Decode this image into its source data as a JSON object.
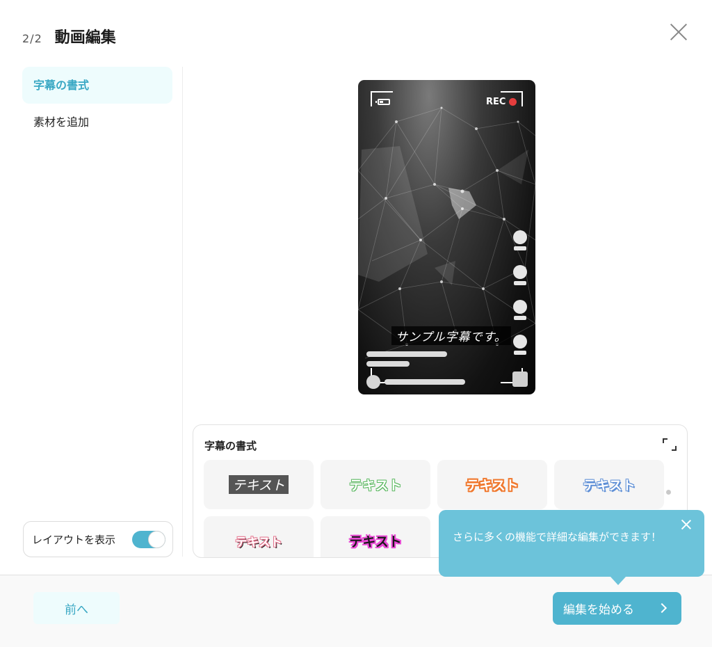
{
  "header": {
    "step": "2/2",
    "title": "動画編集"
  },
  "sidebar": {
    "items": [
      {
        "label": "字幕の書式",
        "active": true
      },
      {
        "label": "素材を追加",
        "active": false
      }
    ]
  },
  "layout_toggle": {
    "label": "レイアウトを表示",
    "on": true
  },
  "preview": {
    "rec_label": "REC",
    "subtitle": "サンプル字幕です。"
  },
  "style_panel": {
    "title": "字幕の書式",
    "styles": [
      {
        "label": "テキスト",
        "name": "style-dark-box"
      },
      {
        "label": "テキスト",
        "name": "style-green-outline"
      },
      {
        "label": "テキスト",
        "name": "style-orange-outline"
      },
      {
        "label": "テキスト",
        "name": "style-blue-outline"
      },
      {
        "label": "テキスト",
        "name": "style-pink-shadow"
      },
      {
        "label": "テキスト",
        "name": "style-magenta-outline"
      }
    ]
  },
  "tooltip": {
    "text": "さらに多くの機能で詳細な編集ができます！"
  },
  "footer": {
    "prev_label": "前へ",
    "start_label": "編集を始める"
  },
  "colors": {
    "accent": "#4fb4cf",
    "accent_light": "#eefcfd",
    "rec_dot": "#e53d3d"
  }
}
